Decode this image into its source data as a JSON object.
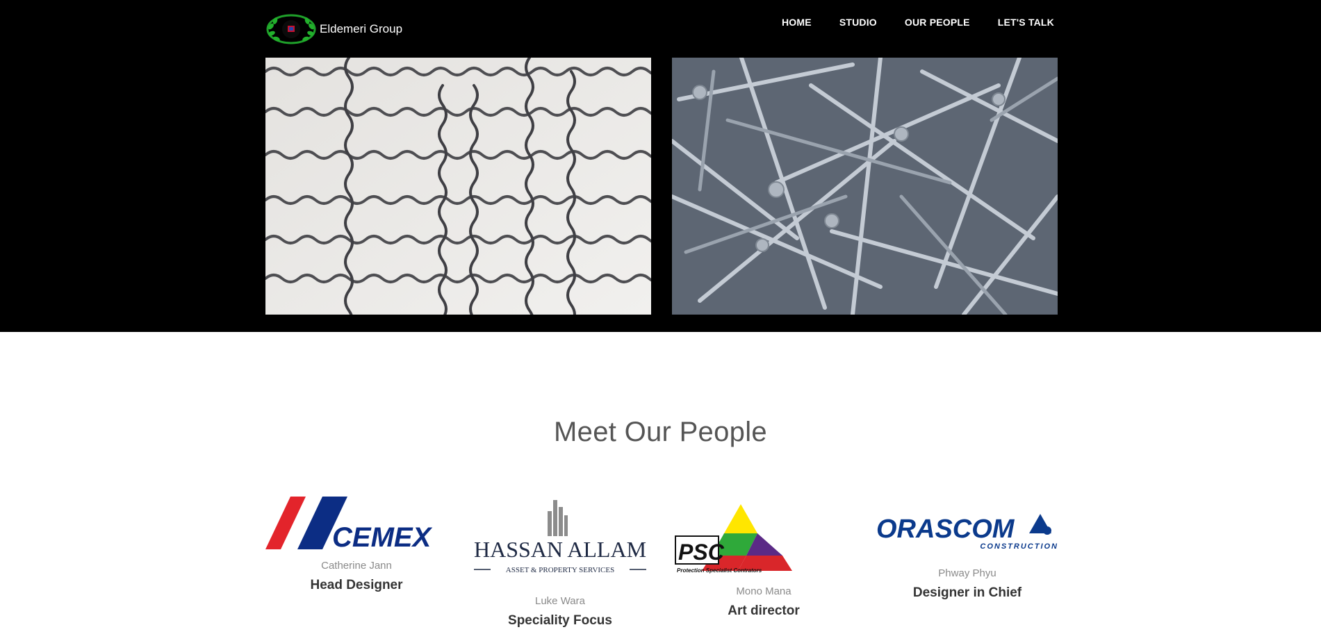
{
  "header": {
    "brand_name": "Eldemeri Group",
    "nav": [
      "HOME",
      "STUDIO",
      "OUR PEOPLE",
      "LET'S TALK"
    ]
  },
  "section": {
    "title": "Meet Our People"
  },
  "people": [
    {
      "logo_text": "CEMEX",
      "name": "Catherine Jann",
      "role": "Head Designer"
    },
    {
      "logo_text": "HASSAN ALLAM",
      "logo_subtext": "ASSET & PROPERTY SERVICES",
      "name": "Luke Wara",
      "role": "Speciality Focus"
    },
    {
      "logo_text": "PSC",
      "logo_subtext": "Protection Specialist Contrators",
      "name": "Mono Mana",
      "role": "Art director"
    },
    {
      "logo_text": "ORASCOM",
      "logo_subtext": "CONSTRUCTION",
      "name": "Phway Phyu",
      "role": "Designer in Chief"
    }
  ],
  "colors": {
    "header_bg": "#000000",
    "cemex_red": "#e3242b",
    "cemex_blue": "#0c2d84",
    "orascom_blue": "#0b3a8c"
  }
}
